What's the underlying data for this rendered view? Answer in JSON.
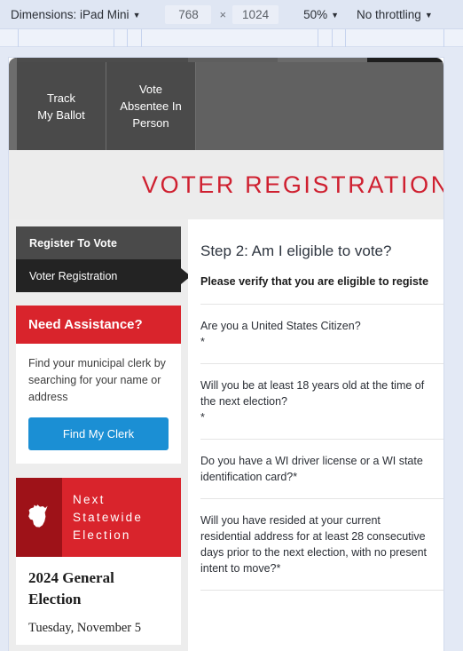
{
  "devtools": {
    "dimensions_label": "Dimensions: iPad Mini",
    "width_value": "768",
    "times_symbol": "×",
    "height_value": "1024",
    "zoom_value": "50%",
    "throttling_value": "No throttling",
    "caret": "▼"
  },
  "site": {
    "topnav": {
      "items": [
        {
          "label": "Track\nMy Ballot"
        },
        {
          "label": "Vote\nAbsentee In\nPerson"
        }
      ]
    },
    "page_title": "VOTER REGISTRATION",
    "sidebar": {
      "nav": [
        {
          "label": "Register To Vote",
          "state": "parent"
        },
        {
          "label": "Voter Registration",
          "state": "active"
        }
      ],
      "assistance": {
        "heading": "Need Assistance?",
        "text": "Find your municipal clerk by searching for your name or address",
        "button_label": "Find My Clerk"
      },
      "election": {
        "heading": "Next\nStatewide\nElection",
        "name": "2024 General Election",
        "date": "Tuesday, November 5"
      }
    },
    "content": {
      "step_title": "Step 2: Am I eligible to vote?",
      "verify_text": "Please verify that you are eligible to registe",
      "questions": [
        "Are you a United States Citizen?\n*",
        "Will you be at least 18 years old at the time of the next election?\n*",
        "Do you have a WI driver license or a WI state identification card?*",
        "Will you have resided at your current residential address for at least 28 consecutive days prior to the next election, with no present intent to move?*"
      ]
    }
  },
  "colors": {
    "brand_red": "#d9242c",
    "brand_dark_red": "#9e1218",
    "title_red": "#cf2030",
    "accent_blue": "#1b8fd4",
    "nav_dark": "#4a4a4a",
    "nav_active": "#232323"
  }
}
